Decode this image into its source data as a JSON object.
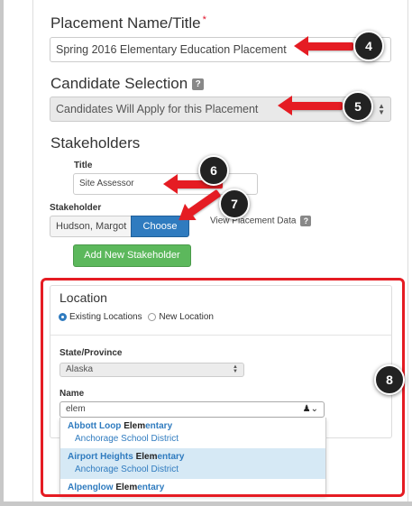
{
  "placement": {
    "label": "Placement Name/Title",
    "required_mark": "*",
    "value": "Spring 2016 Elementary Education Placement"
  },
  "candidate": {
    "label": "Candidate Selection",
    "help": "?",
    "value": "Candidates Will Apply for this Placement"
  },
  "stakeholders": {
    "label": "Stakeholders",
    "title_label": "Title",
    "title_value": "Site Assessor",
    "stakeholder_label": "Stakeholder",
    "stakeholder_value": "Hudson, Margot",
    "choose": "Choose",
    "view_data": "View Placement Data",
    "view_help": "?",
    "add": "Add New Stakeholder"
  },
  "location": {
    "label": "Location",
    "opt_existing": "Existing Locations",
    "opt_new": "New Location",
    "state_label": "State/Province",
    "state_value": "Alaska",
    "name_label": "Name",
    "name_value": "elem",
    "results": [
      {
        "pre": "Abbott Loop ",
        "match": "Elem",
        "post": "entary",
        "district": "Anchorage School District"
      },
      {
        "pre": "Airport Heights ",
        "match": "Elem",
        "post": "entary",
        "district": "Anchorage School District"
      },
      {
        "pre": "Alpenglow ",
        "match": "Elem",
        "post": "entary",
        "district": ""
      }
    ]
  },
  "callouts": [
    "4",
    "5",
    "6",
    "7",
    "8"
  ],
  "colors": {
    "accent": "#e51c23",
    "primary": "#2f7bbf",
    "success": "#5cb85c"
  }
}
